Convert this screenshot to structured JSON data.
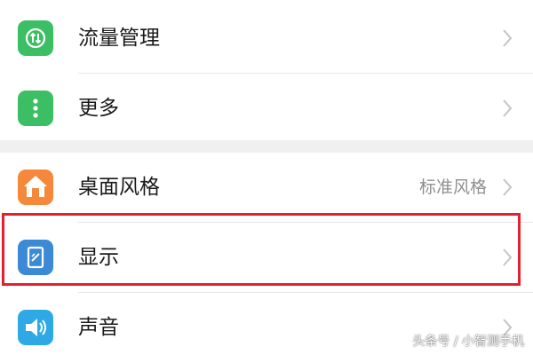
{
  "settings": {
    "items": [
      {
        "label": "流量管理",
        "value": "",
        "icon": "traffic-arrows-icon",
        "color": "#3cbf64"
      },
      {
        "label": "更多",
        "value": "",
        "icon": "more-dots-icon",
        "color": "#3cbf64"
      },
      {
        "label": "桌面风格",
        "value": "标准风格",
        "icon": "home-icon",
        "color": "#f5883a"
      },
      {
        "label": "显示",
        "value": "",
        "icon": "display-icon",
        "color": "#3c8ad6"
      },
      {
        "label": "声音",
        "value": "",
        "icon": "speaker-icon",
        "color": "#2ea9e6"
      }
    ]
  },
  "watermark": "头条号 / 小智测手机",
  "colors": {
    "highlight_border": "#e4202f",
    "section_gap": "#f0f0f0",
    "chevron": "#c4c4c4"
  }
}
